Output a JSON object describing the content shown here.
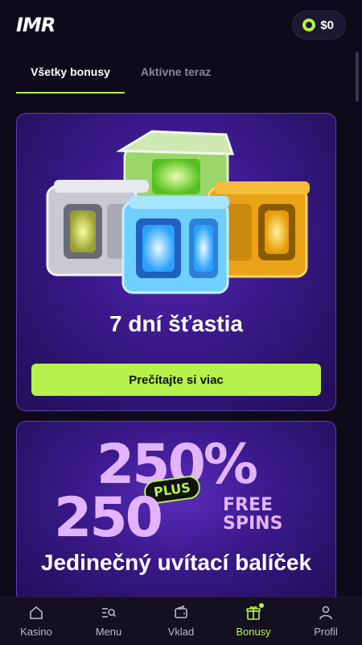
{
  "header": {
    "logo": "IMR",
    "balance": "$0"
  },
  "tabs": [
    {
      "label": "Všetky bonusy",
      "active": true
    },
    {
      "label": "Aktívne teraz",
      "active": false
    }
  ],
  "cards": [
    {
      "title": "7 dní šťastia",
      "button": "Prečítajte si viac"
    },
    {
      "promo_line1": "250%",
      "badge": "PLUS",
      "promo_line2": "250",
      "promo_line2_suffix_1": "FREE",
      "promo_line2_suffix_2": "SPINS",
      "title": "Jedinečný uvítací balíček"
    }
  ],
  "bottom_nav": [
    {
      "label": "Kasino",
      "icon": "home-icon",
      "active": false
    },
    {
      "label": "Menu",
      "icon": "menu-search-icon",
      "active": false
    },
    {
      "label": "Vklad",
      "icon": "wallet-icon",
      "active": false
    },
    {
      "label": "Bonusy",
      "icon": "gift-icon",
      "active": true
    },
    {
      "label": "Profil",
      "icon": "user-icon",
      "active": false
    }
  ],
  "colors": {
    "accent": "#b6f24b",
    "background": "#0e0a1a",
    "card": "#3c1a8e"
  }
}
